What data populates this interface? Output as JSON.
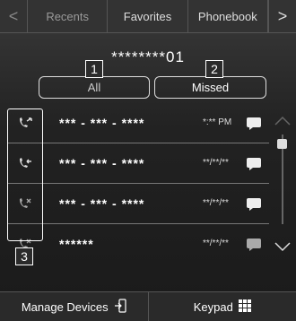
{
  "tabs": {
    "prev_arrow": "<",
    "next_arrow": ">",
    "items": [
      "Recents",
      "Favorites",
      "Phonebook"
    ]
  },
  "phone_number": "********01",
  "callouts": [
    "1",
    "2",
    "3"
  ],
  "filters": {
    "all_label": "All",
    "missed_label": "Missed"
  },
  "calls": [
    {
      "icon": "outgoing-call-icon",
      "number": "*** - *** - ****",
      "time": "*:** PM"
    },
    {
      "icon": "incoming-call-icon",
      "number": "*** - *** - ****",
      "time": "**/**/**"
    },
    {
      "icon": "missed-call-icon",
      "number": "*** - *** - ****",
      "time": "**/**/**"
    },
    {
      "icon": "missed-call-icon",
      "number": "******",
      "time": "**/**/**"
    }
  ],
  "bottom": {
    "manage_devices": "Manage Devices",
    "keypad": "Keypad"
  },
  "colors": {
    "background": "#2b2b2b",
    "text": "#ffffff",
    "divider": "#777777"
  }
}
